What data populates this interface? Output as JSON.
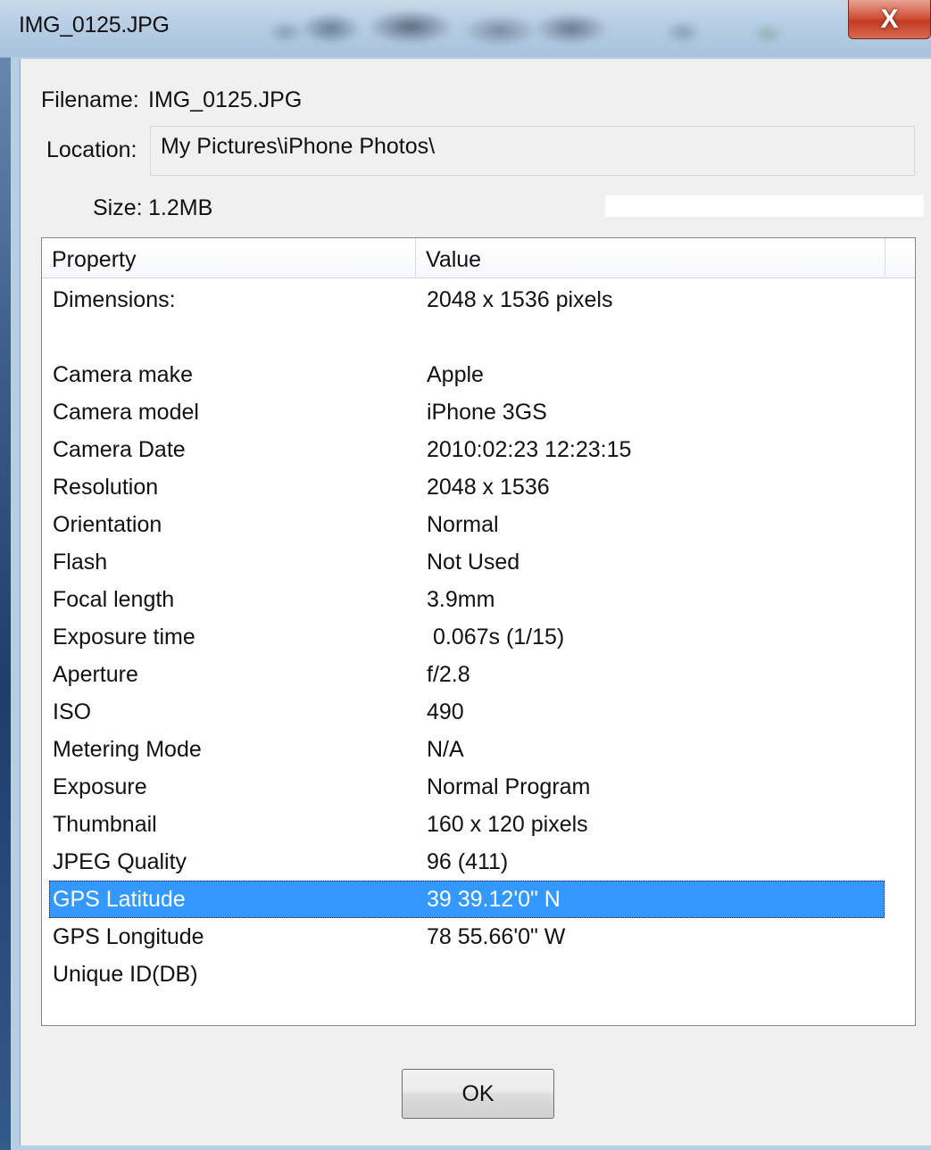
{
  "window": {
    "title": "IMG_0125.JPG",
    "close_glyph": "X"
  },
  "info": {
    "filename_label": "Filename:",
    "filename_value": "IMG_0125.JPG",
    "location_label": "Location:",
    "location_value": "My Pictures\\iPhone Photos\\",
    "size_label": "Size:",
    "size_value": "1.2MB"
  },
  "table": {
    "columns": [
      "Property",
      "Value"
    ],
    "selected_color": "#3399ff",
    "rows": [
      {
        "property": "Dimensions:",
        "value": "2048 x 1536 pixels"
      },
      {
        "property": "",
        "value": ""
      },
      {
        "property": "Camera make",
        "value": "Apple"
      },
      {
        "property": "Camera model",
        "value": "iPhone 3GS"
      },
      {
        "property": "Camera Date",
        "value": "2010:02:23 12:23:15"
      },
      {
        "property": "Resolution",
        "value": "2048 x 1536"
      },
      {
        "property": "Orientation",
        "value": "Normal"
      },
      {
        "property": "Flash",
        "value": "Not Used"
      },
      {
        "property": "Focal length",
        "value": "3.9mm"
      },
      {
        "property": "Exposure time",
        "value": " 0.067s (1/15)"
      },
      {
        "property": "Aperture",
        "value": "f/2.8"
      },
      {
        "property": "ISO",
        "value": "490"
      },
      {
        "property": "Metering Mode",
        "value": "N/A"
      },
      {
        "property": "Exposure",
        "value": "Normal Program"
      },
      {
        "property": "Thumbnail",
        "value": "160 x 120 pixels"
      },
      {
        "property": "JPEG Quality",
        "value": "96 (411)"
      },
      {
        "property": "GPS Latitude",
        "value": "39 39.12'0\" N",
        "selected": true
      },
      {
        "property": "GPS Longitude",
        "value": "78 55.66'0\" W"
      },
      {
        "property": "Unique ID(DB)",
        "value": ""
      }
    ]
  },
  "buttons": {
    "ok_label": "OK"
  }
}
